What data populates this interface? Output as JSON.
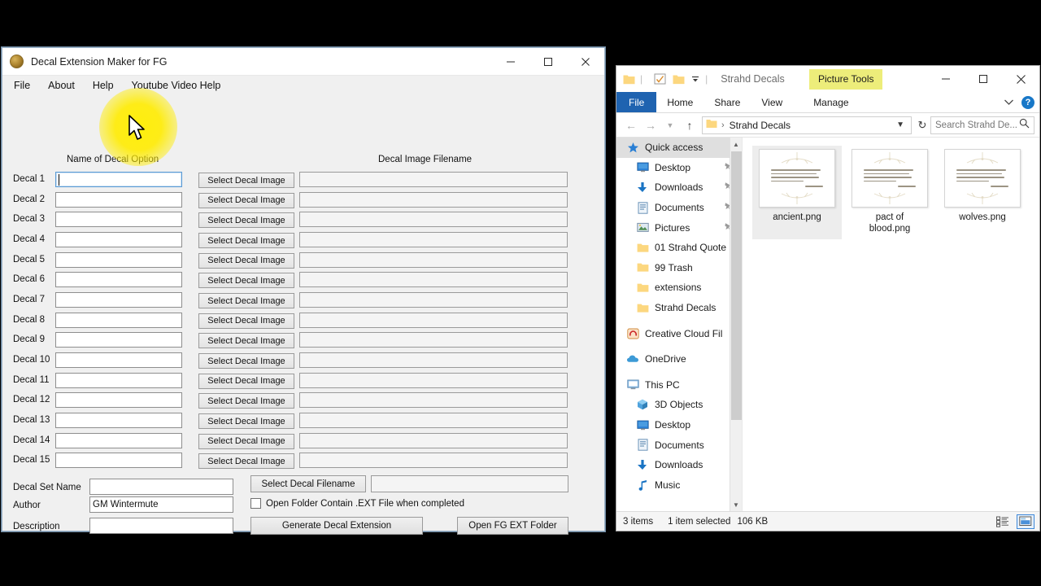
{
  "app": {
    "title": "Decal Extension Maker for FG",
    "icon": "app-logo-icon",
    "menu": [
      "File",
      "About",
      "Help",
      "Youtube Video Help"
    ],
    "window_controls": {
      "minimize": "minimize-icon",
      "maximize": "maximize-icon",
      "close": "close-icon"
    },
    "headers": {
      "name_col": "Name of Decal Option",
      "filename_col": "Decal Image Filename"
    },
    "decal_rows": [
      {
        "label": "Decal 1",
        "name_value": "",
        "button": "Select Decal Image",
        "file_value": "",
        "focused": true
      },
      {
        "label": "Decal 2",
        "name_value": "",
        "button": "Select Decal Image",
        "file_value": "",
        "focused": false
      },
      {
        "label": "Decal 3",
        "name_value": "",
        "button": "Select Decal Image",
        "file_value": "",
        "focused": false
      },
      {
        "label": "Decal 4",
        "name_value": "",
        "button": "Select Decal Image",
        "file_value": "",
        "focused": false
      },
      {
        "label": "Decal 5",
        "name_value": "",
        "button": "Select Decal Image",
        "file_value": "",
        "focused": false
      },
      {
        "label": "Decal 6",
        "name_value": "",
        "button": "Select Decal Image",
        "file_value": "",
        "focused": false
      },
      {
        "label": "Decal 7",
        "name_value": "",
        "button": "Select Decal Image",
        "file_value": "",
        "focused": false
      },
      {
        "label": "Decal 8",
        "name_value": "",
        "button": "Select Decal Image",
        "file_value": "",
        "focused": false
      },
      {
        "label": "Decal 9",
        "name_value": "",
        "button": "Select Decal Image",
        "file_value": "",
        "focused": false
      },
      {
        "label": "Decal 10",
        "name_value": "",
        "button": "Select Decal Image",
        "file_value": "",
        "focused": false
      },
      {
        "label": "Decal 11",
        "name_value": "",
        "button": "Select Decal Image",
        "file_value": "",
        "focused": false
      },
      {
        "label": "Decal 12",
        "name_value": "",
        "button": "Select Decal Image",
        "file_value": "",
        "focused": false
      },
      {
        "label": "Decal 13",
        "name_value": "",
        "button": "Select Decal Image",
        "file_value": "",
        "focused": false
      },
      {
        "label": "Decal 14",
        "name_value": "",
        "button": "Select Decal Image",
        "file_value": "",
        "focused": false
      },
      {
        "label": "Decal 15",
        "name_value": "",
        "button": "Select Decal Image",
        "file_value": "",
        "focused": false
      }
    ],
    "bottom": {
      "set_name_label": "Decal Set Name",
      "set_name_value": "",
      "author_label": "Author",
      "author_value": "GM Wintermute",
      "description_label": "Description",
      "description_value": "",
      "select_filename_button": "Select Decal Filename",
      "filename_path_value": "",
      "open_folder_checkbox_label": "Open Folder Contain .EXT File when completed",
      "open_folder_checked": false,
      "generate_button": "Generate Decal Extension",
      "open_fg_button": "Open FG EXT Folder"
    }
  },
  "cursor": {
    "icon": "mouse-pointer-icon",
    "highlight_color": "#ffec00"
  },
  "explorer": {
    "title": "Strahd Decals",
    "contextual_tab_group": "Picture Tools",
    "quick_access": [
      "folder-icon",
      "properties-icon",
      "new-folder-icon",
      "customize-dropdown-icon"
    ],
    "window_controls": {
      "minimize": "minimize-icon",
      "maximize": "maximize-icon",
      "close": "close-icon"
    },
    "ribbon_tabs": [
      "File",
      "Home",
      "Share",
      "View",
      "Manage"
    ],
    "ribbon_active_tab": "File",
    "help_icon_label": "?",
    "address": {
      "crumb": "Strahd Decals",
      "folder_icon": "folder-icon"
    },
    "search": {
      "placeholder": "Search Strahd De...",
      "icon": "search-icon"
    },
    "nav_items": [
      {
        "label": "Quick access",
        "icon": "star-icon",
        "selected": true,
        "pinned": false,
        "indent": false
      },
      {
        "label": "Desktop",
        "icon": "desktop-icon",
        "selected": false,
        "pinned": true,
        "indent": true
      },
      {
        "label": "Downloads",
        "icon": "downloads-icon",
        "selected": false,
        "pinned": true,
        "indent": true
      },
      {
        "label": "Documents",
        "icon": "documents-icon",
        "selected": false,
        "pinned": true,
        "indent": true
      },
      {
        "label": "Pictures",
        "icon": "pictures-icon",
        "selected": false,
        "pinned": true,
        "indent": true
      },
      {
        "label": "01 Strahd Quote",
        "icon": "folder-icon",
        "selected": false,
        "pinned": false,
        "indent": true
      },
      {
        "label": "99 Trash",
        "icon": "folder-icon",
        "selected": false,
        "pinned": false,
        "indent": true
      },
      {
        "label": "extensions",
        "icon": "folder-icon",
        "selected": false,
        "pinned": false,
        "indent": true
      },
      {
        "label": "Strahd Decals",
        "icon": "folder-icon",
        "selected": false,
        "pinned": false,
        "indent": true
      },
      {
        "label": "",
        "icon": "spacer",
        "selected": false,
        "pinned": false,
        "indent": false
      },
      {
        "label": "Creative Cloud Fil",
        "icon": "creative-cloud-icon",
        "selected": false,
        "pinned": false,
        "indent": false
      },
      {
        "label": "",
        "icon": "spacer",
        "selected": false,
        "pinned": false,
        "indent": false
      },
      {
        "label": "OneDrive",
        "icon": "onedrive-icon",
        "selected": false,
        "pinned": false,
        "indent": false
      },
      {
        "label": "",
        "icon": "spacer",
        "selected": false,
        "pinned": false,
        "indent": false
      },
      {
        "label": "This PC",
        "icon": "this-pc-icon",
        "selected": false,
        "pinned": false,
        "indent": false
      },
      {
        "label": "3D Objects",
        "icon": "3d-objects-icon",
        "selected": false,
        "pinned": false,
        "indent": true
      },
      {
        "label": "Desktop",
        "icon": "desktop-icon",
        "selected": false,
        "pinned": false,
        "indent": true
      },
      {
        "label": "Documents",
        "icon": "documents-icon",
        "selected": false,
        "pinned": false,
        "indent": true
      },
      {
        "label": "Downloads",
        "icon": "downloads-icon",
        "selected": false,
        "pinned": false,
        "indent": true
      },
      {
        "label": "Music",
        "icon": "music-icon",
        "selected": false,
        "pinned": false,
        "indent": true
      }
    ],
    "files": [
      {
        "name": "ancient.png",
        "selected": true
      },
      {
        "name": "pact of\nblood.png",
        "selected": false
      },
      {
        "name": "wolves.png",
        "selected": false
      }
    ],
    "status": {
      "items": "3 items",
      "selection": "1 item selected",
      "size": "106 KB",
      "view_details_icon": "details-view-icon",
      "view_large_icons_icon": "large-icons-view-icon",
      "active_view": "large-icons-view-icon"
    }
  }
}
